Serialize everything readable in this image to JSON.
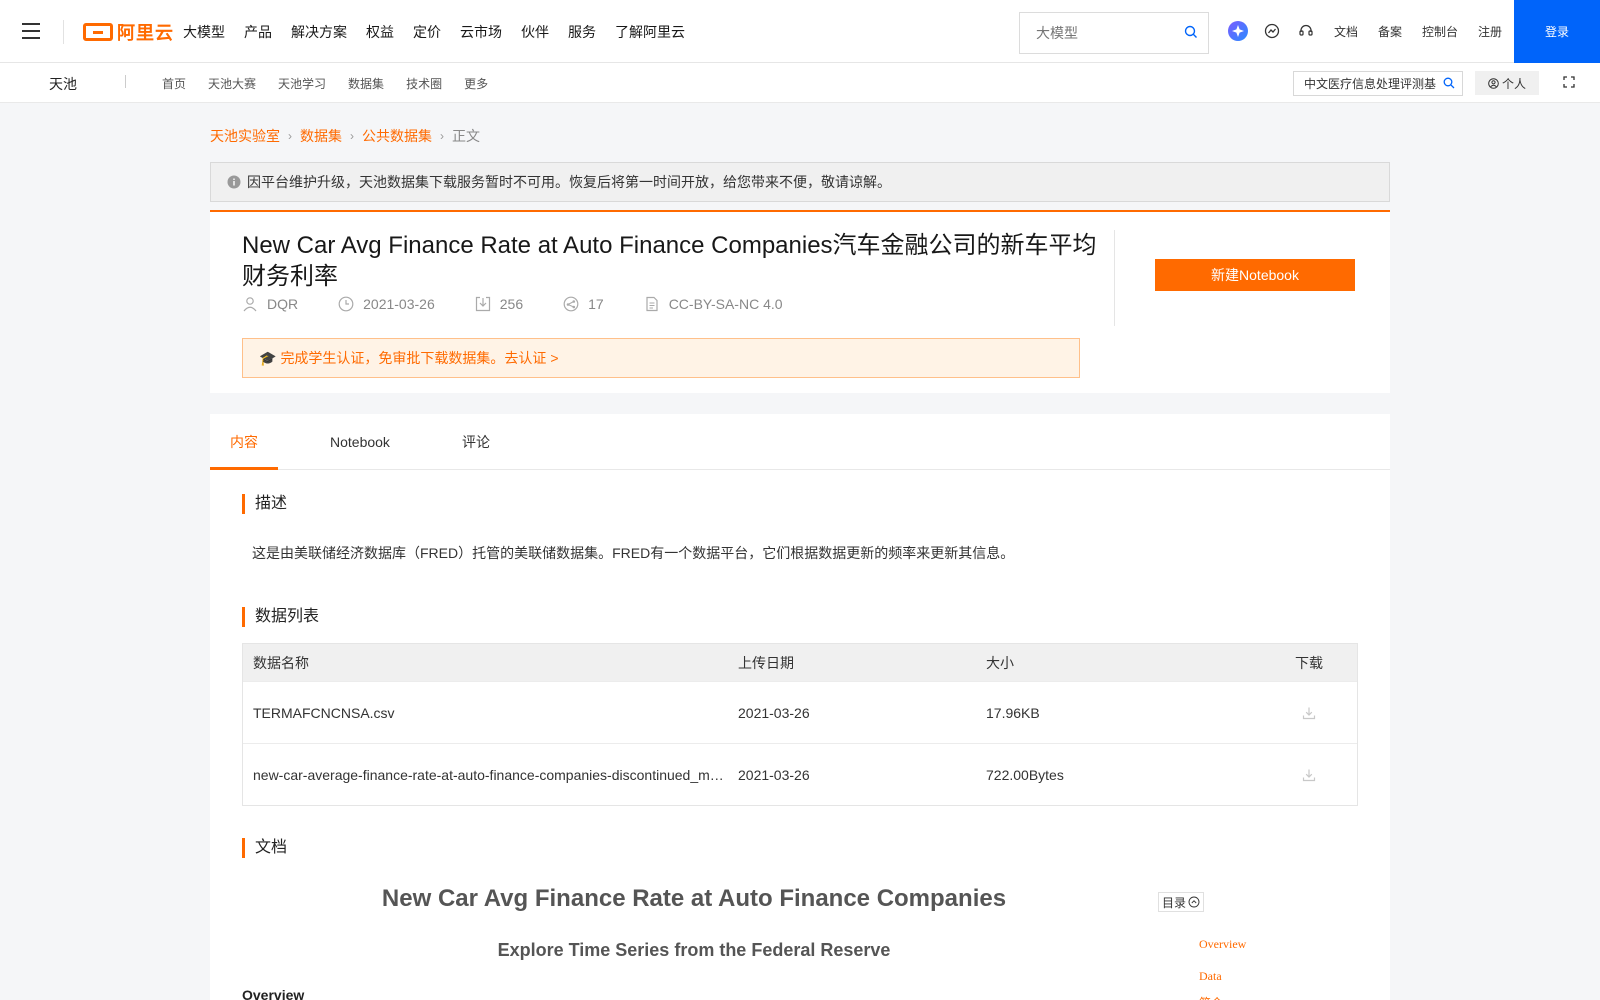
{
  "topnav": {
    "logo_text": "阿里云",
    "menu": [
      "大模型",
      "产品",
      "解决方案",
      "权益",
      "定价",
      "云市场",
      "伙伴",
      "服务",
      "了解阿里云"
    ],
    "search_placeholder": "大模型",
    "links": [
      "文档",
      "备案",
      "控制台",
      "注册"
    ],
    "login": "登录",
    "accent": "#ff6a00",
    "login_color": "#0064fa"
  },
  "subnav": {
    "title": "天池",
    "menu": [
      "首页",
      "天池大赛",
      "天池学习",
      "数据集",
      "技术圈",
      "更多"
    ],
    "search_value": "中文医疗信息处理评测基",
    "personal": "个人"
  },
  "breadcrumb": [
    "天池实验室",
    "数据集",
    "公共数据集",
    "正文"
  ],
  "notice": "因平台维护升级，天池数据集下载服务暂时不可用。恢复后将第一时间开放，给您带来不便，敬请谅解。",
  "dataset": {
    "title": "New Car Avg Finance Rate at Auto Finance Companies汽车金融公司的新车平均财务利率",
    "author": "DQR",
    "date": "2021-03-26",
    "downloads": "256",
    "shares": "17",
    "license": "CC-BY-SA-NC 4.0",
    "student_notice": "完成学生认证，免审批下载数据集。去认证 >",
    "new_notebook": "新建Notebook"
  },
  "tabs": [
    "内容",
    "Notebook",
    "评论"
  ],
  "sections": {
    "desc_title": "描述",
    "desc_text": "这是由美联储经济数据库（FRED）托管的美联储数据集。FRED有一个数据平台，它们根据数据更新的频率来更新其信息。",
    "list_title": "数据列表",
    "doc_title": "文档"
  },
  "table": {
    "headers": [
      "数据名称",
      "上传日期",
      "大小",
      "下载"
    ],
    "rows": [
      {
        "name": "TERMAFCNCNSA.csv",
        "date": "2021-03-26",
        "size": "17.96KB"
      },
      {
        "name": "new-car-average-finance-rate-at-auto-finance-companies-discontinued_metadata.json",
        "date": "2021-03-26",
        "size": "722.00Bytes"
      }
    ]
  },
  "doc": {
    "h1": "New Car Avg Finance Rate at Auto Finance Companies",
    "h2": "Explore Time Series from the Federal Reserve",
    "h3": "Overview",
    "toc_label": "目录",
    "toc": [
      "Overview",
      "Data",
      "简介"
    ]
  }
}
